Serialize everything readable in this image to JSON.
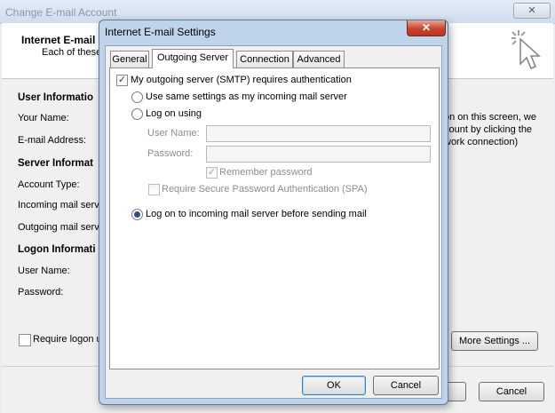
{
  "background_window": {
    "title": "Change E-mail Account",
    "close_glyph": "✕",
    "header_title": "Internet E-mail",
    "header_subtitle": "Each of these",
    "sections": {
      "user_info": "User Informatio",
      "server_info": "Server Informat",
      "logon_info": "Logon Informati"
    },
    "labels": {
      "your_name": "Your Name:",
      "email_address": "E-mail Address:",
      "account_type": "Account Type:",
      "incoming_server": "Incoming mail serve",
      "outgoing_server": "Outgoing mail serve",
      "user_name": "User Name:",
      "password": "Password:"
    },
    "right_text": [
      "on on this screen, we",
      "count by clicking the",
      "work connection)"
    ],
    "require_logon_label": "Require logon u",
    "more_settings_button": "More Settings ...",
    "cancel_button": "Cancel"
  },
  "dialog": {
    "title": "Internet E-mail Settings",
    "close_glyph": "✕",
    "tabs": {
      "general": "General",
      "outgoing_server": "Outgoing Server",
      "connection": "Connection",
      "advanced": "Advanced"
    },
    "smtp_auth": {
      "label": "My outgoing server (SMTP) requires authentication",
      "checked": true,
      "mark": "✓"
    },
    "use_same_settings": {
      "label": "Use same settings as my incoming mail server",
      "selected": false
    },
    "log_on_using": {
      "label": "Log on using",
      "selected": false
    },
    "user_name_label": "User Name:",
    "user_name_value": "",
    "password_label": "Password:",
    "password_value": "",
    "remember_password": {
      "label": "Remember password",
      "checked": true,
      "mark": "✓"
    },
    "require_spa": {
      "label": "Require Secure Password Authentication (SPA)",
      "checked": false
    },
    "log_on_incoming_first": {
      "label": "Log on to incoming mail server before sending mail",
      "selected": true
    },
    "ok_button": "OK",
    "cancel_button": "Cancel"
  }
}
